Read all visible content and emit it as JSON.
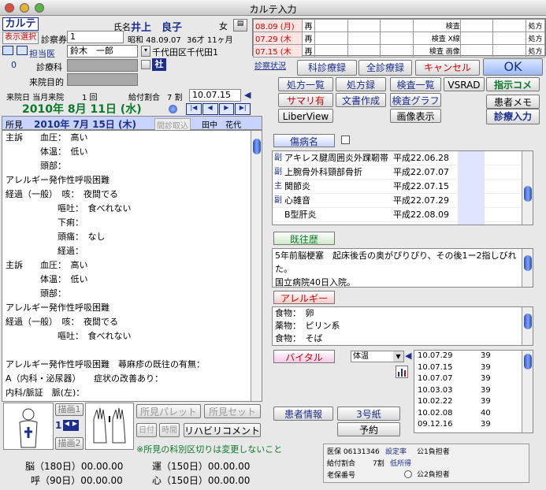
{
  "window": {
    "title": "カルテ入力"
  },
  "header": {
    "karte_label": "カルテ",
    "display_select": "表示選択",
    "name_label": "氏名",
    "patient_name": "井上　良子",
    "sex": "女",
    "insurance_label": "診察券",
    "insurance_value": "1",
    "birth": "昭和 48.09.07",
    "age": "36才 11ヶ月",
    "doctor_label": "担当医",
    "doctor_value": "鈴木　一郎",
    "address": "千代田区千代田1",
    "shaho": "社",
    "dept_label": "診療科",
    "dept_count": "0",
    "purpose_label": "来院目的",
    "visit_label": "来院日 当月来院",
    "visit_count": "1 回",
    "payment_label": "給付割合",
    "payment_value": "7 割",
    "date_input": "10.07.15",
    "date_display": "2010年 8月 11日 (水)"
  },
  "history": [
    {
      "date": "08.09 (月)",
      "tag": "再"
    },
    {
      "date": "07.29 (木",
      "tag": "再"
    },
    {
      "date": "07.15 (木",
      "tag": "再"
    }
  ],
  "history_right": [
    {
      "label": "検査",
      "rx": "処方"
    },
    {
      "label": "検査 X線",
      "rx": "処方"
    },
    {
      "label": "検査 画像",
      "rx": "処方"
    }
  ],
  "buttons": {
    "status": "診察状況",
    "past_record": "科診療録",
    "all_record": "全診療録",
    "cancel": "キャンセル",
    "ok": "OK",
    "rx_list": "処方一覧",
    "rx_record": "処方録",
    "exam_list": "検査一覧",
    "vsrad": "VSRAD",
    "order_comment": "指示コメ",
    "summary": "サマリ有",
    "doc_create": "文書作成",
    "exam_graph": "検査グラフ",
    "patient_memo": "患者メモ",
    "liberview": "LiberView",
    "image_view": "画像表示",
    "diag_input": "診療入力"
  },
  "findings": {
    "label": "所見",
    "date": "2010年 7月 15日 (木)",
    "inter_btn": "間診取込",
    "doctor": "田中　花代",
    "lines": [
      "主訴　　血圧：　高い",
      "　　　　体温：　低い",
      "　　　　頭部：",
      "アレルギー発作性呼吸困難",
      "経過（一般）　咳：　夜間でる",
      "　　　　　　嘔吐：　食べれない",
      "　　　　　　下痢：",
      "　　　　　　頭痛：　なし",
      "　　　　　　経過：",
      "主訴　　血圧：　高い",
      "　　　　体温：　低い",
      "　　　　頭部：",
      "アレルギー発作性呼吸困難",
      "経過（一般）　咳：　夜間でる",
      "　　　　　　嘔吐：　食べれない",
      "",
      "アレルギー発作性呼吸困難　蕁麻疹の既往の有無：",
      "A（内科・泌尿器）　　症状の改善あり：",
      "内科/脈証　脈(左)："
    ]
  },
  "drawing": {
    "draw1": "描画1",
    "draw2": "描画2",
    "page": "1",
    "palette": "所見パレット",
    "set": "所見セット",
    "date_btn": "日付",
    "time_btn": "時間",
    "rehab": "リハビリコメント",
    "note": "※所見の科別区切りは変更しないこと"
  },
  "rehab": {
    "brain": "脳（180日）00.00.00",
    "move": "運（150日）00.00.00",
    "breath": "呼（90日）00.00.00",
    "heart": "心（150日）00.00.00"
  },
  "disease": {
    "button": "傷病名",
    "rows": [
      {
        "tag": "副",
        "name": "アキレス腱周囲炎外踝靭帯",
        "date": "平成22.06.28"
      },
      {
        "tag": "副",
        "name": "上腕骨外科頸部骨折",
        "date": "平成22.07.07"
      },
      {
        "tag": "主",
        "name": "関節炎",
        "date": "平成22.07.15"
      },
      {
        "tag": "副",
        "name": "心雑音",
        "date": "平成22.07.29"
      },
      {
        "tag": "",
        "name": "B型肝炎",
        "date": "平成22.08.09"
      }
    ]
  },
  "past": {
    "button": "既往歴",
    "lines": [
      "5年前脳梗塞　起床後舌の奥がぴりぴり、その後1ー2指しびれた。",
      "国立病院40日入院。"
    ]
  },
  "allergy": {
    "button": "アレルギー",
    "lines": [
      "食物：　卵",
      "薬物：　ピリン系",
      "食物：　そば"
    ]
  },
  "vital": {
    "button": "バイタル",
    "select": "体温",
    "rows": [
      {
        "date": "10.07.29",
        "val": "39"
      },
      {
        "date": "10.07.15",
        "val": "39"
      },
      {
        "date": "10.07.07",
        "val": "39"
      },
      {
        "date": "10.03.03",
        "val": "39"
      },
      {
        "date": "10.02.22",
        "val": "39"
      },
      {
        "date": "10.02.08",
        "val": "40"
      },
      {
        "date": "09.12.16",
        "val": "39"
      }
    ]
  },
  "patient_info": "患者情報",
  "form3": "3号紙",
  "reserve": "予約",
  "insurance": {
    "iryo": "医保 06131346",
    "setting": "設定率",
    "kohi1": "公1負担者",
    "payment": "給付割合",
    "payment_val": "7割",
    "low": "低所得",
    "rojin": "老保番号",
    "kohi2": "公2負担者"
  },
  "colors": {
    "accent": "#1c2f8f",
    "red": "#c00",
    "green": "#0a7a2a"
  }
}
